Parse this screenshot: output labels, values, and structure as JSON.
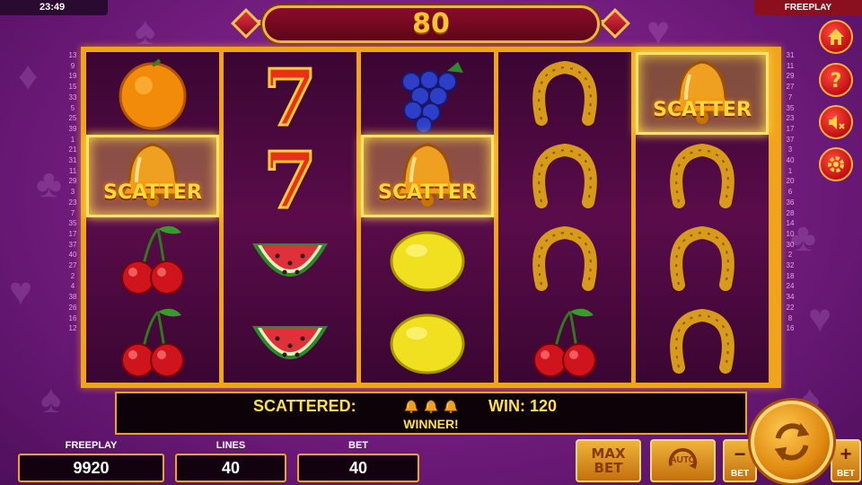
{
  "topbar": {
    "clock": "23:49",
    "mode": "FREEPLAY"
  },
  "banner": {
    "win_amount": "80"
  },
  "scatter_text": "SCATTER",
  "reels": [
    [
      "orange",
      "bell-scatter",
      "cherry",
      "cherry"
    ],
    [
      "seven",
      "seven",
      "watermelon",
      "watermelon"
    ],
    [
      "grapes",
      "bell-scatter",
      "lemon",
      "lemon"
    ],
    [
      "horseshoe",
      "horseshoe",
      "horseshoe",
      "cherry"
    ],
    [
      "bell-scatter",
      "horseshoe",
      "horseshoe",
      "horseshoe"
    ]
  ],
  "line_numbers_left": [
    "13",
    "9",
    "19",
    "15",
    "33",
    "5",
    "25",
    "39",
    "1",
    "21",
    "31",
    "11",
    "29",
    "3",
    "23",
    "7",
    "35",
    "17",
    "37",
    "40",
    "27",
    "2",
    "4",
    "38",
    "26",
    "16",
    "12"
  ],
  "line_numbers_right": [
    "31",
    "11",
    "29",
    "27",
    "7",
    "35",
    "23",
    "17",
    "37",
    "3",
    "40",
    "1",
    "20",
    "6",
    "36",
    "28",
    "14",
    "10",
    "30",
    "2",
    "32",
    "18",
    "24",
    "34",
    "22",
    "8",
    "16"
  ],
  "info_bar": {
    "scattered_label": "SCATTERED:",
    "win_label": "WIN:",
    "win_value": "120",
    "winner_text": "WINNER!",
    "scatter_count": 3
  },
  "stats": {
    "freeplay_label": "FREEPLAY",
    "freeplay_value": "9920",
    "lines_label": "LINES",
    "lines_value": "40",
    "bet_label": "BET",
    "bet_value": "40"
  },
  "buttons": {
    "maxbet_line1": "MAX",
    "maxbet_line2": "BET",
    "auto": "AUTO",
    "bet_minus": "BET",
    "bet_plus": "BET",
    "minus_sym": "−",
    "plus_sym": "+"
  },
  "side_buttons": [
    "home-icon",
    "help-icon",
    "mute-icon",
    "settings-icon"
  ],
  "colors": {
    "accent": "#f0a41c",
    "banner_text": "#ffc52e",
    "info_text": "#ffe04a",
    "side_button": "#d3161d"
  }
}
